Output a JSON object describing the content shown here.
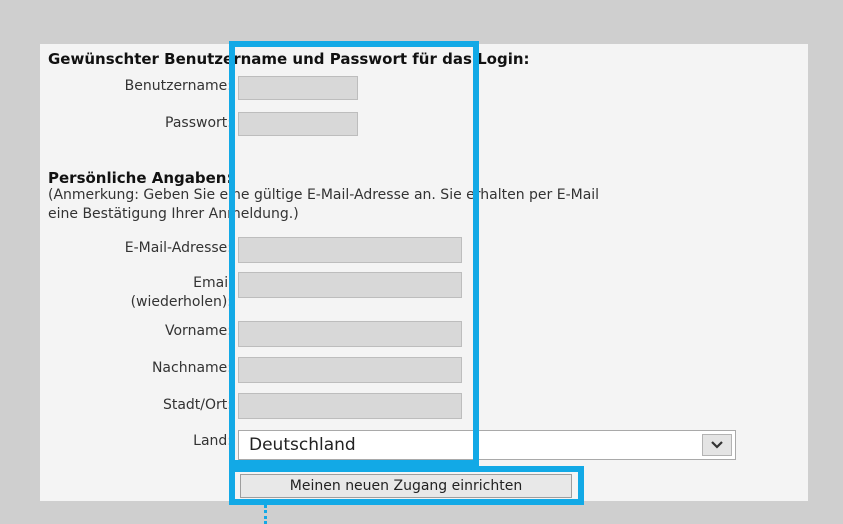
{
  "login_section": {
    "heading": "Gewünschter Benutzername und Passwort für das Login:",
    "username_label": "Benutzername:",
    "password_label": "Passwort:"
  },
  "personal_section": {
    "heading": "Persönliche Angaben:",
    "note_line1": "(Anmerkung: Geben Sie eine gültige E-Mail-Adresse an. Sie erhalten per E-Mail",
    "note_line2": "eine Bestätigung Ihrer Anmeldung.)",
    "email_label": "E-Mail-Adresse:",
    "email_repeat_label_line1": "Email",
    "email_repeat_label_line2": "(wiederholen):",
    "firstname_label": "Vorname:",
    "lastname_label": "Nachname:",
    "city_label": "Stadt/Ort:",
    "country_label": "Land:",
    "country_value": "Deutschland"
  },
  "submit_label": "Meinen neuen Zugang einrichten",
  "icons": {
    "dropdown": "chevron-down-icon"
  },
  "colors": {
    "highlight": "#12a9e6",
    "page_bg": "#cfcfcf",
    "panel_bg": "#f4f4f4"
  }
}
